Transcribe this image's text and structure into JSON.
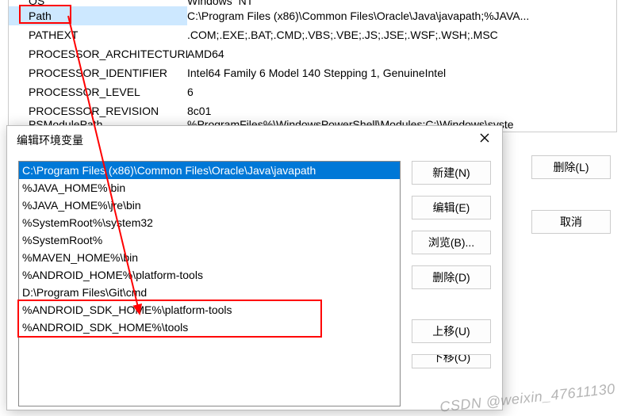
{
  "env_rows": [
    {
      "name": "OS",
      "value": "Windows_NT"
    },
    {
      "name": "Path",
      "value": "C:\\Program Files (x86)\\Common Files\\Oracle\\Java\\javapath;%JAVA..."
    },
    {
      "name": "PATHEXT",
      "value": ".COM;.EXE;.BAT;.CMD;.VBS;.VBE;.JS;.JSE;.WSF;.WSH;.MSC"
    },
    {
      "name": "PROCESSOR_ARCHITECTURE",
      "value": "AMD64"
    },
    {
      "name": "PROCESSOR_IDENTIFIER",
      "value": "Intel64 Family 6 Model 140 Stepping 1, GenuineIntel"
    },
    {
      "name": "PROCESSOR_LEVEL",
      "value": "6"
    },
    {
      "name": "PROCESSOR_REVISION",
      "value": "8c01"
    },
    {
      "name": "PSModulePath",
      "value": "%ProgramFiles%\\WindowsPowerShell\\Modules;C:\\Windows\\syste"
    }
  ],
  "back_buttons": {
    "delete": "删除(L)",
    "cancel": "取消"
  },
  "dialog": {
    "title": "编辑环境变量",
    "paths": [
      "C:\\Program Files (x86)\\Common Files\\Oracle\\Java\\javapath",
      "%JAVA_HOME%\\bin",
      "%JAVA_HOME%\\jre\\bin",
      "%SystemRoot%\\system32",
      "%SystemRoot%",
      "%MAVEN_HOME%\\bin",
      "%ANDROID_HOME%\\platform-tools",
      "D:\\Program Files\\Git\\cmd",
      "%ANDROID_SDK_HOME%\\platform-tools",
      "%ANDROID_SDK_HOME%\\tools"
    ],
    "buttons": {
      "new": "新建(N)",
      "edit": "编辑(E)",
      "browse": "浏览(B)...",
      "delete": "删除(D)",
      "moveup": "上移(U)",
      "movedown": "下移(O)"
    }
  },
  "watermark": "CSDN @weixin_47611130"
}
